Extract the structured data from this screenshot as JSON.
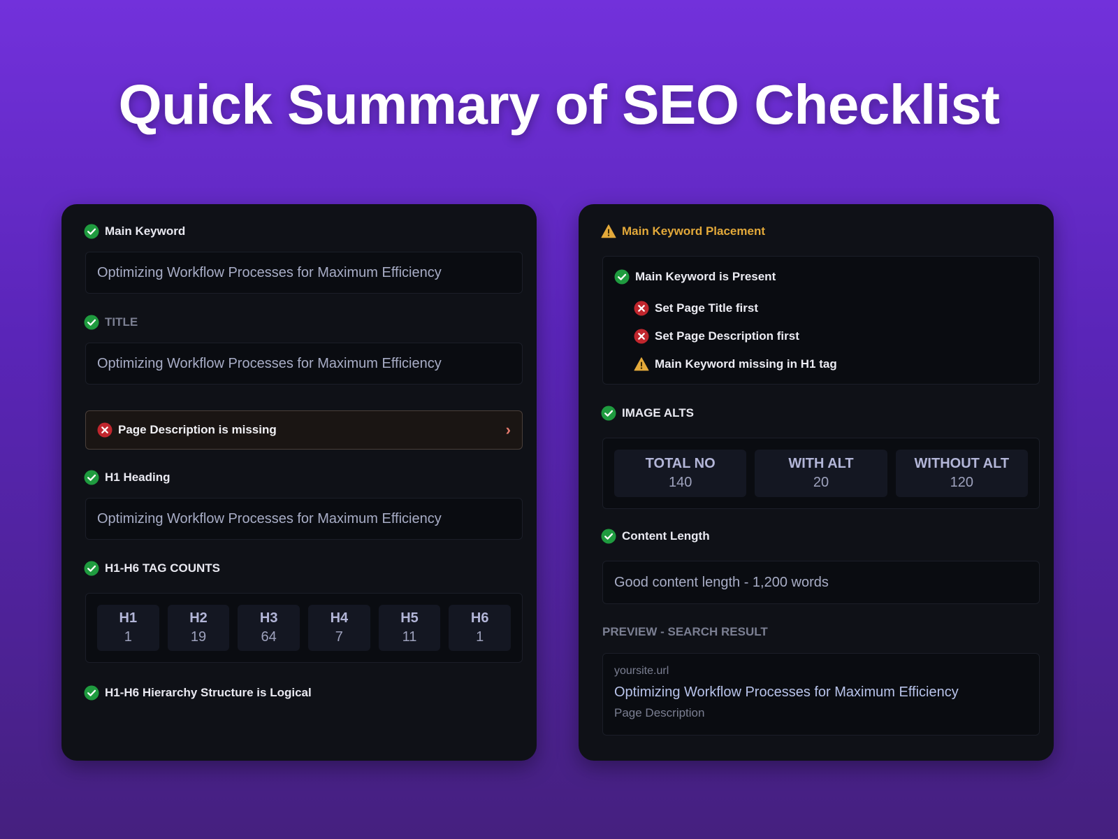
{
  "page_title": "Quick Summary of SEO Checklist",
  "colors": {
    "ok": "#1f9b3f",
    "error": "#c0262d",
    "warn": "#e3a93a"
  },
  "left": {
    "main_keyword": {
      "icon": "check-circle-icon",
      "label": "Main Keyword",
      "value": "Optimizing Workflow Processes for Maximum Efficiency"
    },
    "title": {
      "icon": "check-circle-icon",
      "label": "TITLE",
      "value": "Optimizing Workflow Processes for Maximum Efficiency"
    },
    "description_alert": {
      "icon": "x-circle-icon",
      "label": "Page Description is missing",
      "chevron": "chevron-right-icon"
    },
    "h1_heading": {
      "icon": "check-circle-icon",
      "label": "H1 Heading",
      "value": "Optimizing Workflow Processes for Maximum Efficiency"
    },
    "tag_counts": {
      "icon": "check-circle-icon",
      "label": "H1-H6 TAG COUNTS",
      "items": [
        {
          "tag": "H1",
          "count": "1"
        },
        {
          "tag": "H2",
          "count": "19"
        },
        {
          "tag": "H3",
          "count": "64"
        },
        {
          "tag": "H4",
          "count": "7"
        },
        {
          "tag": "H5",
          "count": "11"
        },
        {
          "tag": "H6",
          "count": "1"
        }
      ]
    },
    "hierarchy": {
      "icon": "check-circle-icon",
      "label": "H1-H6 Hierarchy Structure is Logical"
    }
  },
  "right": {
    "placement": {
      "icon": "warning-triangle-icon",
      "label": "Main Keyword Placement",
      "present": {
        "icon": "check-circle-icon",
        "label": "Main Keyword is Present"
      },
      "items": [
        {
          "icon": "x-circle-icon",
          "label": "Set Page Title first"
        },
        {
          "icon": "x-circle-icon",
          "label": "Set Page Description first"
        },
        {
          "icon": "warning-triangle-icon",
          "label": "Main Keyword missing in H1 tag"
        }
      ]
    },
    "image_alts": {
      "icon": "check-circle-icon",
      "label": "IMAGE ALTS",
      "items": [
        {
          "key": "TOTAL NO",
          "value": "140"
        },
        {
          "key": "WITH ALT",
          "value": "20"
        },
        {
          "key": "WITHOUT ALT",
          "value": "120"
        }
      ]
    },
    "content_length": {
      "icon": "check-circle-icon",
      "label": "Content Length",
      "value": "Good content length - 1,200 words"
    },
    "preview": {
      "label": "PREVIEW - SEARCH RESULT",
      "url": "yoursite.url",
      "title": "Optimizing Workflow Processes for Maximum Efficiency",
      "description": "Page Description"
    }
  }
}
